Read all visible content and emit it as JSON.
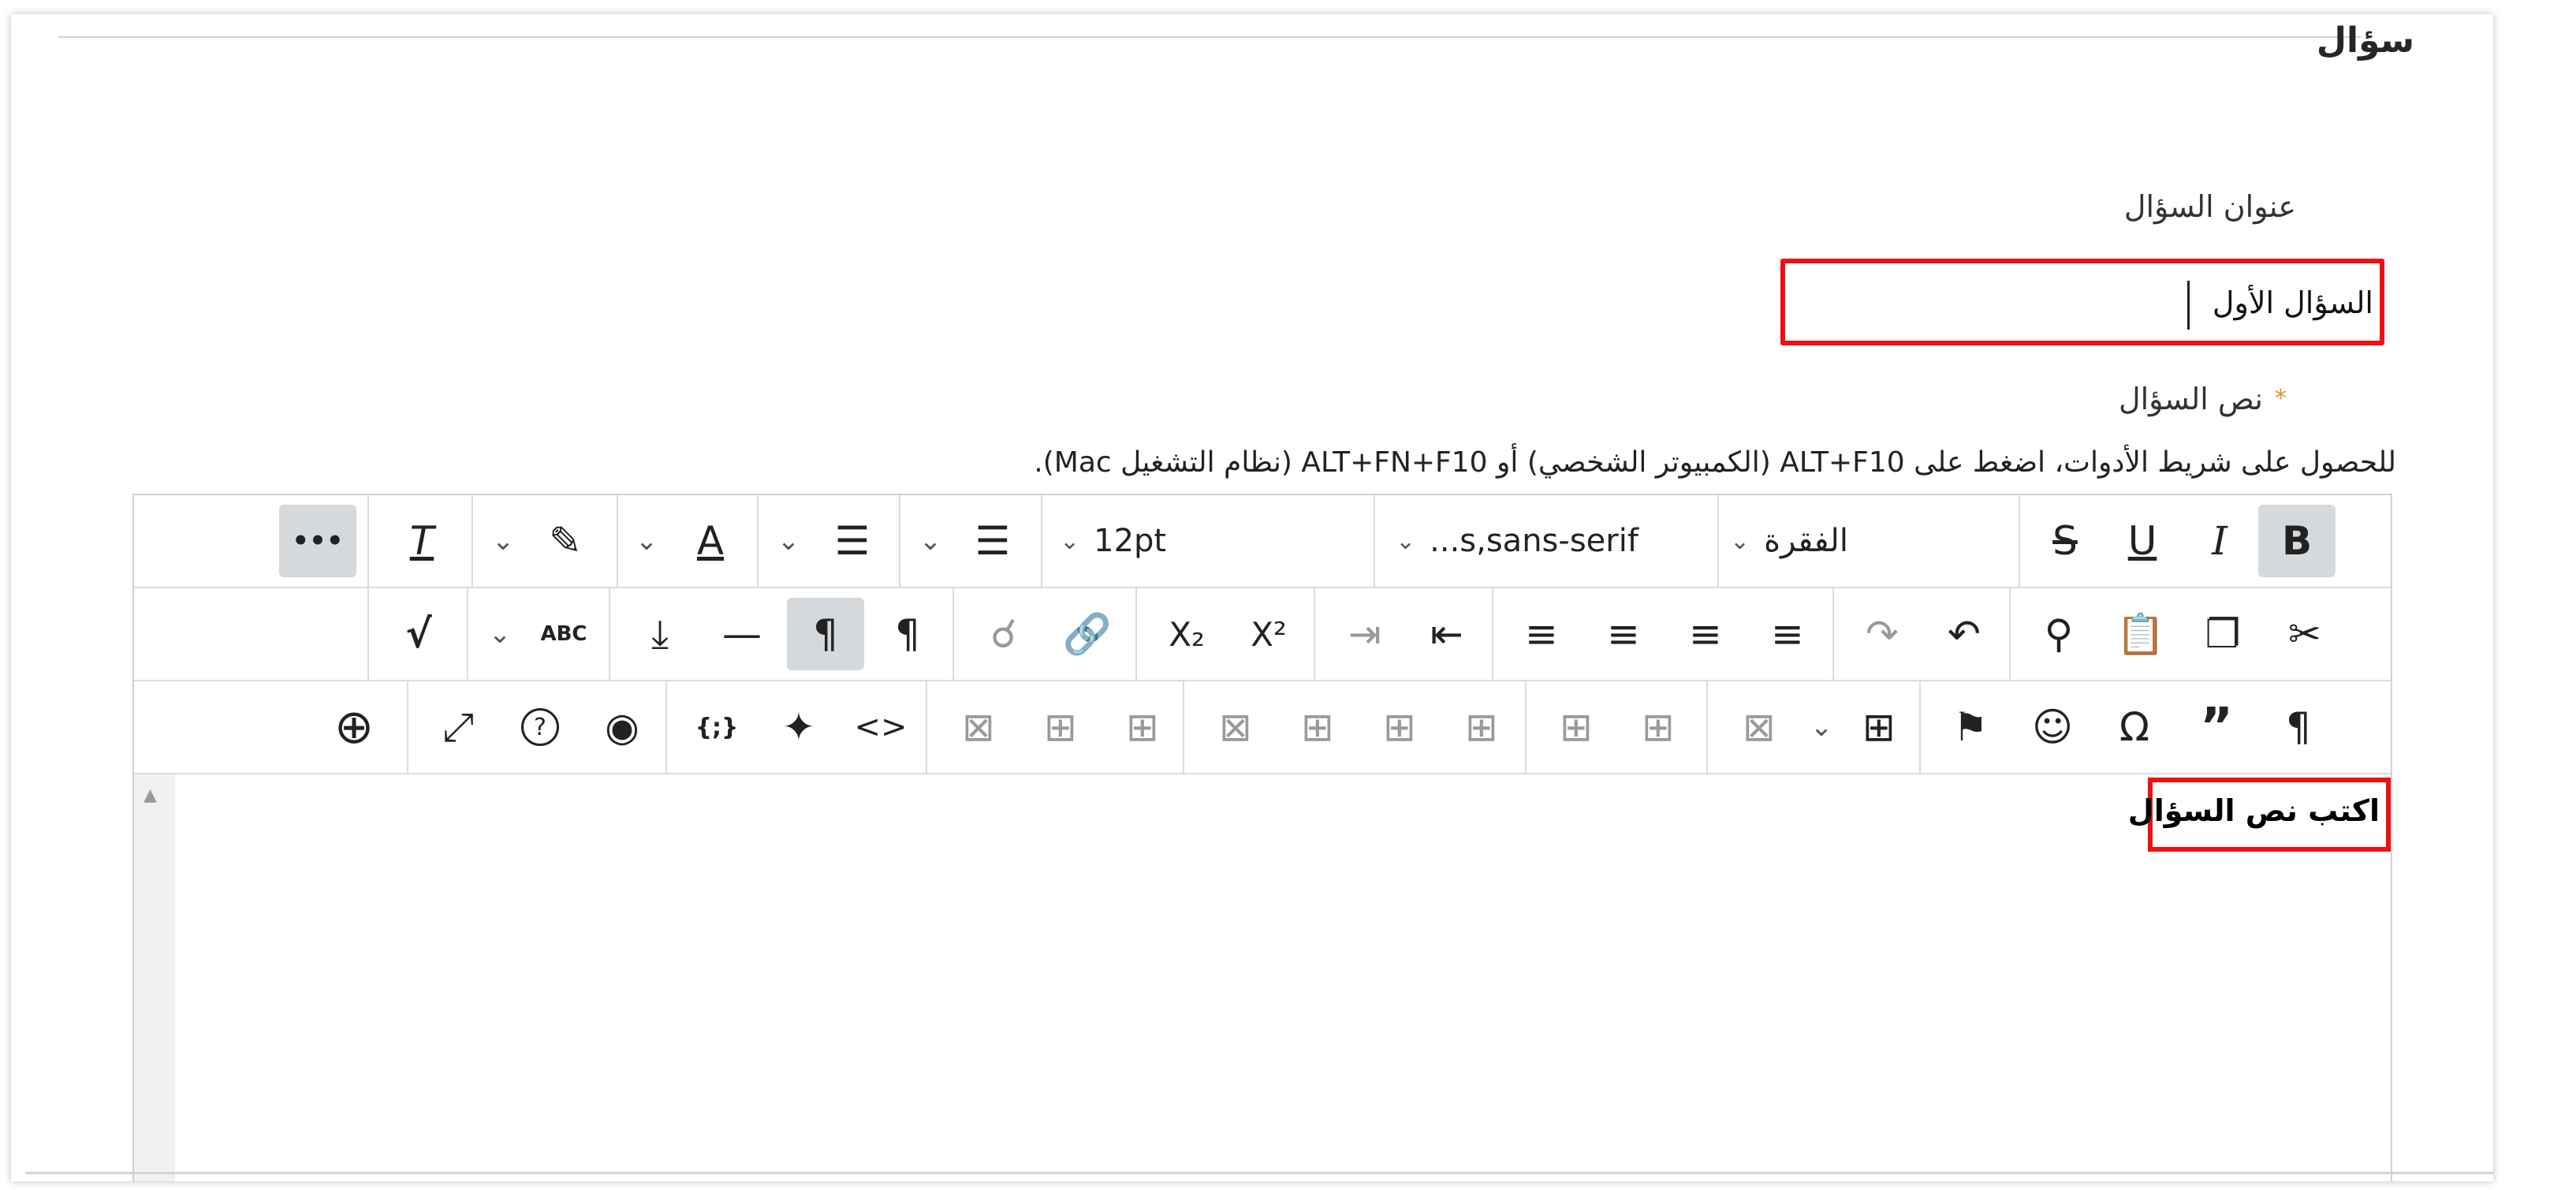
{
  "section": {
    "title": "سؤال"
  },
  "question_title": {
    "label": "عنوان السؤال",
    "value": "السؤال الأول"
  },
  "question_text": {
    "label": "نص السؤال",
    "required_marker": "*",
    "toolbar_help": "للحصول على شريط الأدوات، اضغط على ALT+F10 (الكمبيوتر الشخصي) أو ALT+FN+F10 (نظام التشغيل Mac)."
  },
  "editor": {
    "toolbar": {
      "bold": "B",
      "italic": "I",
      "underline": "U",
      "strikethrough": "S",
      "paragraph_format": "الفقرة",
      "font_family": "...s,sans-serif",
      "font_size": "12pt",
      "more": "•••",
      "subscript": "X₂",
      "superscript": "X²",
      "omega": "Ω",
      "pilcrow": "¶",
      "quote": "”",
      "code_view": "<>",
      "source_code": "{;}",
      "help": "?",
      "spellcheck": "ABC"
    },
    "body_text": "اكتب نص السؤال"
  },
  "colors": {
    "highlight_border": "#ee1111",
    "required_star": "#e0901f",
    "active_button": "#d6d9dc"
  }
}
